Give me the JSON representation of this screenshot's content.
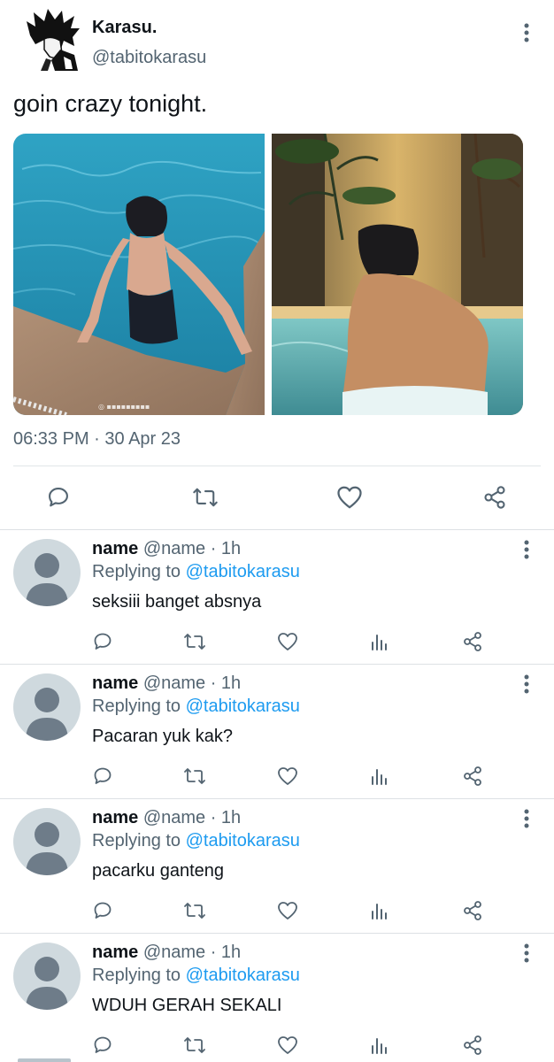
{
  "tweet": {
    "author_name": "Karasu.",
    "author_handle": "@tabitokarasu",
    "text": "goin crazy tonight.",
    "timestamp": "06:33 PM · 30 Apr 23",
    "images": [
      "pool-photo-left",
      "jacuzzi-photo-right"
    ],
    "actions": [
      "reply-icon",
      "retweet-icon",
      "like-icon",
      "share-icon"
    ]
  },
  "replies": [
    {
      "name": "name",
      "handle": "@name",
      "time": "· 1h",
      "replying_label": "Replying to",
      "replying_to": "@tabitokarasu",
      "text": "seksiii banget absnya"
    },
    {
      "name": "name",
      "handle": "@name",
      "time": "· 1h",
      "replying_label": "Replying to",
      "replying_to": "@tabitokarasu",
      "text": "Pacaran yuk kak?"
    },
    {
      "name": "name",
      "handle": "@name",
      "time": "· 1h",
      "replying_label": "Replying to",
      "replying_to": "@tabitokarasu",
      "text": "pacarku ganteng"
    },
    {
      "name": "name",
      "handle": "@name",
      "time": "· 1h",
      "replying_label": "Replying to",
      "replying_to": "@tabitokarasu",
      "text": "WDUH GERAH SEKALI"
    }
  ],
  "reply_actions": [
    "reply-icon",
    "retweet-icon",
    "like-icon",
    "analytics-icon",
    "share-icon"
  ],
  "colors": {
    "text": "#0f1419",
    "secondary": "#536471",
    "link": "#1d9bf0",
    "divider": "#dde1e4",
    "placeholder_avatar": "#cfd9de"
  }
}
